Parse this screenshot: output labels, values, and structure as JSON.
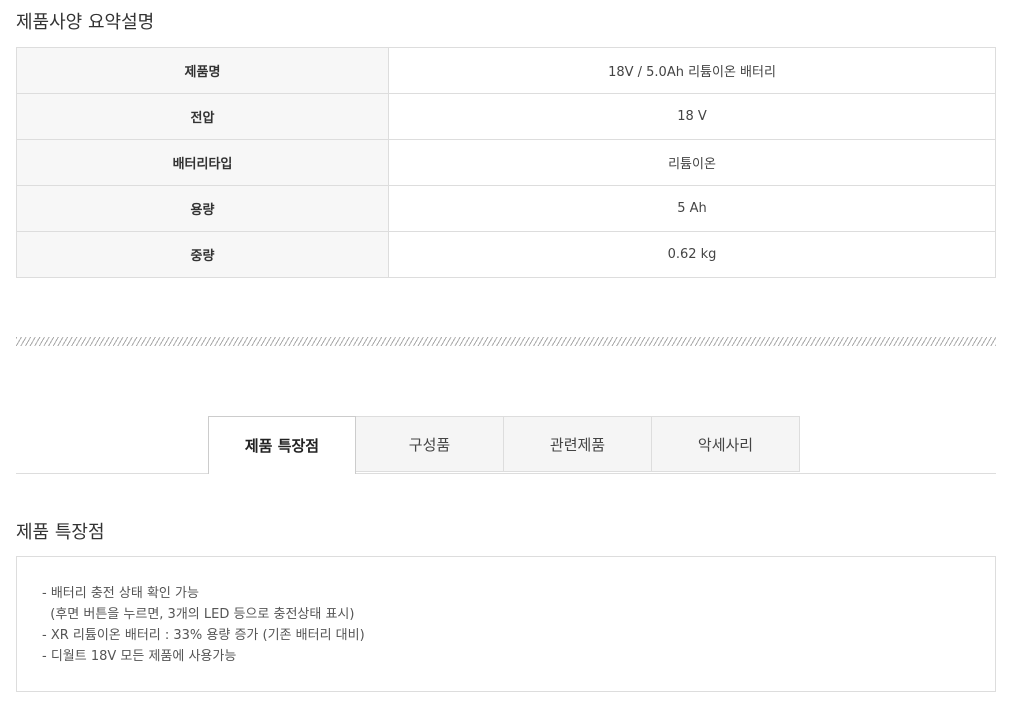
{
  "spec": {
    "title": "제품사양 요약설명",
    "rows": [
      {
        "label": "제품명",
        "value": "18V / 5.0Ah 리튬이온 배터리"
      },
      {
        "label": "전압",
        "value": "18 V"
      },
      {
        "label": "배터리타입",
        "value": "리튬이온"
      },
      {
        "label": "용량",
        "value": "5 Ah"
      },
      {
        "label": "중량",
        "value": "0.62 kg"
      }
    ]
  },
  "tabs": [
    {
      "label": "제품 특장점",
      "active": true
    },
    {
      "label": "구성품",
      "active": false
    },
    {
      "label": "관련제품",
      "active": false
    },
    {
      "label": "악세사리",
      "active": false
    }
  ],
  "features": {
    "title": "제품 특장점",
    "lines": [
      "- 배터리 충전 상태 확인 가능",
      "  (후면 버튼을 누르면, 3개의 LED 등으로 충전상태 표시)",
      "- XR 리튬이온 배터리 : 33% 용량 증가 (기존 배터리 대비)",
      "- 디월트 18V 모든 제품에 사용가능"
    ]
  }
}
